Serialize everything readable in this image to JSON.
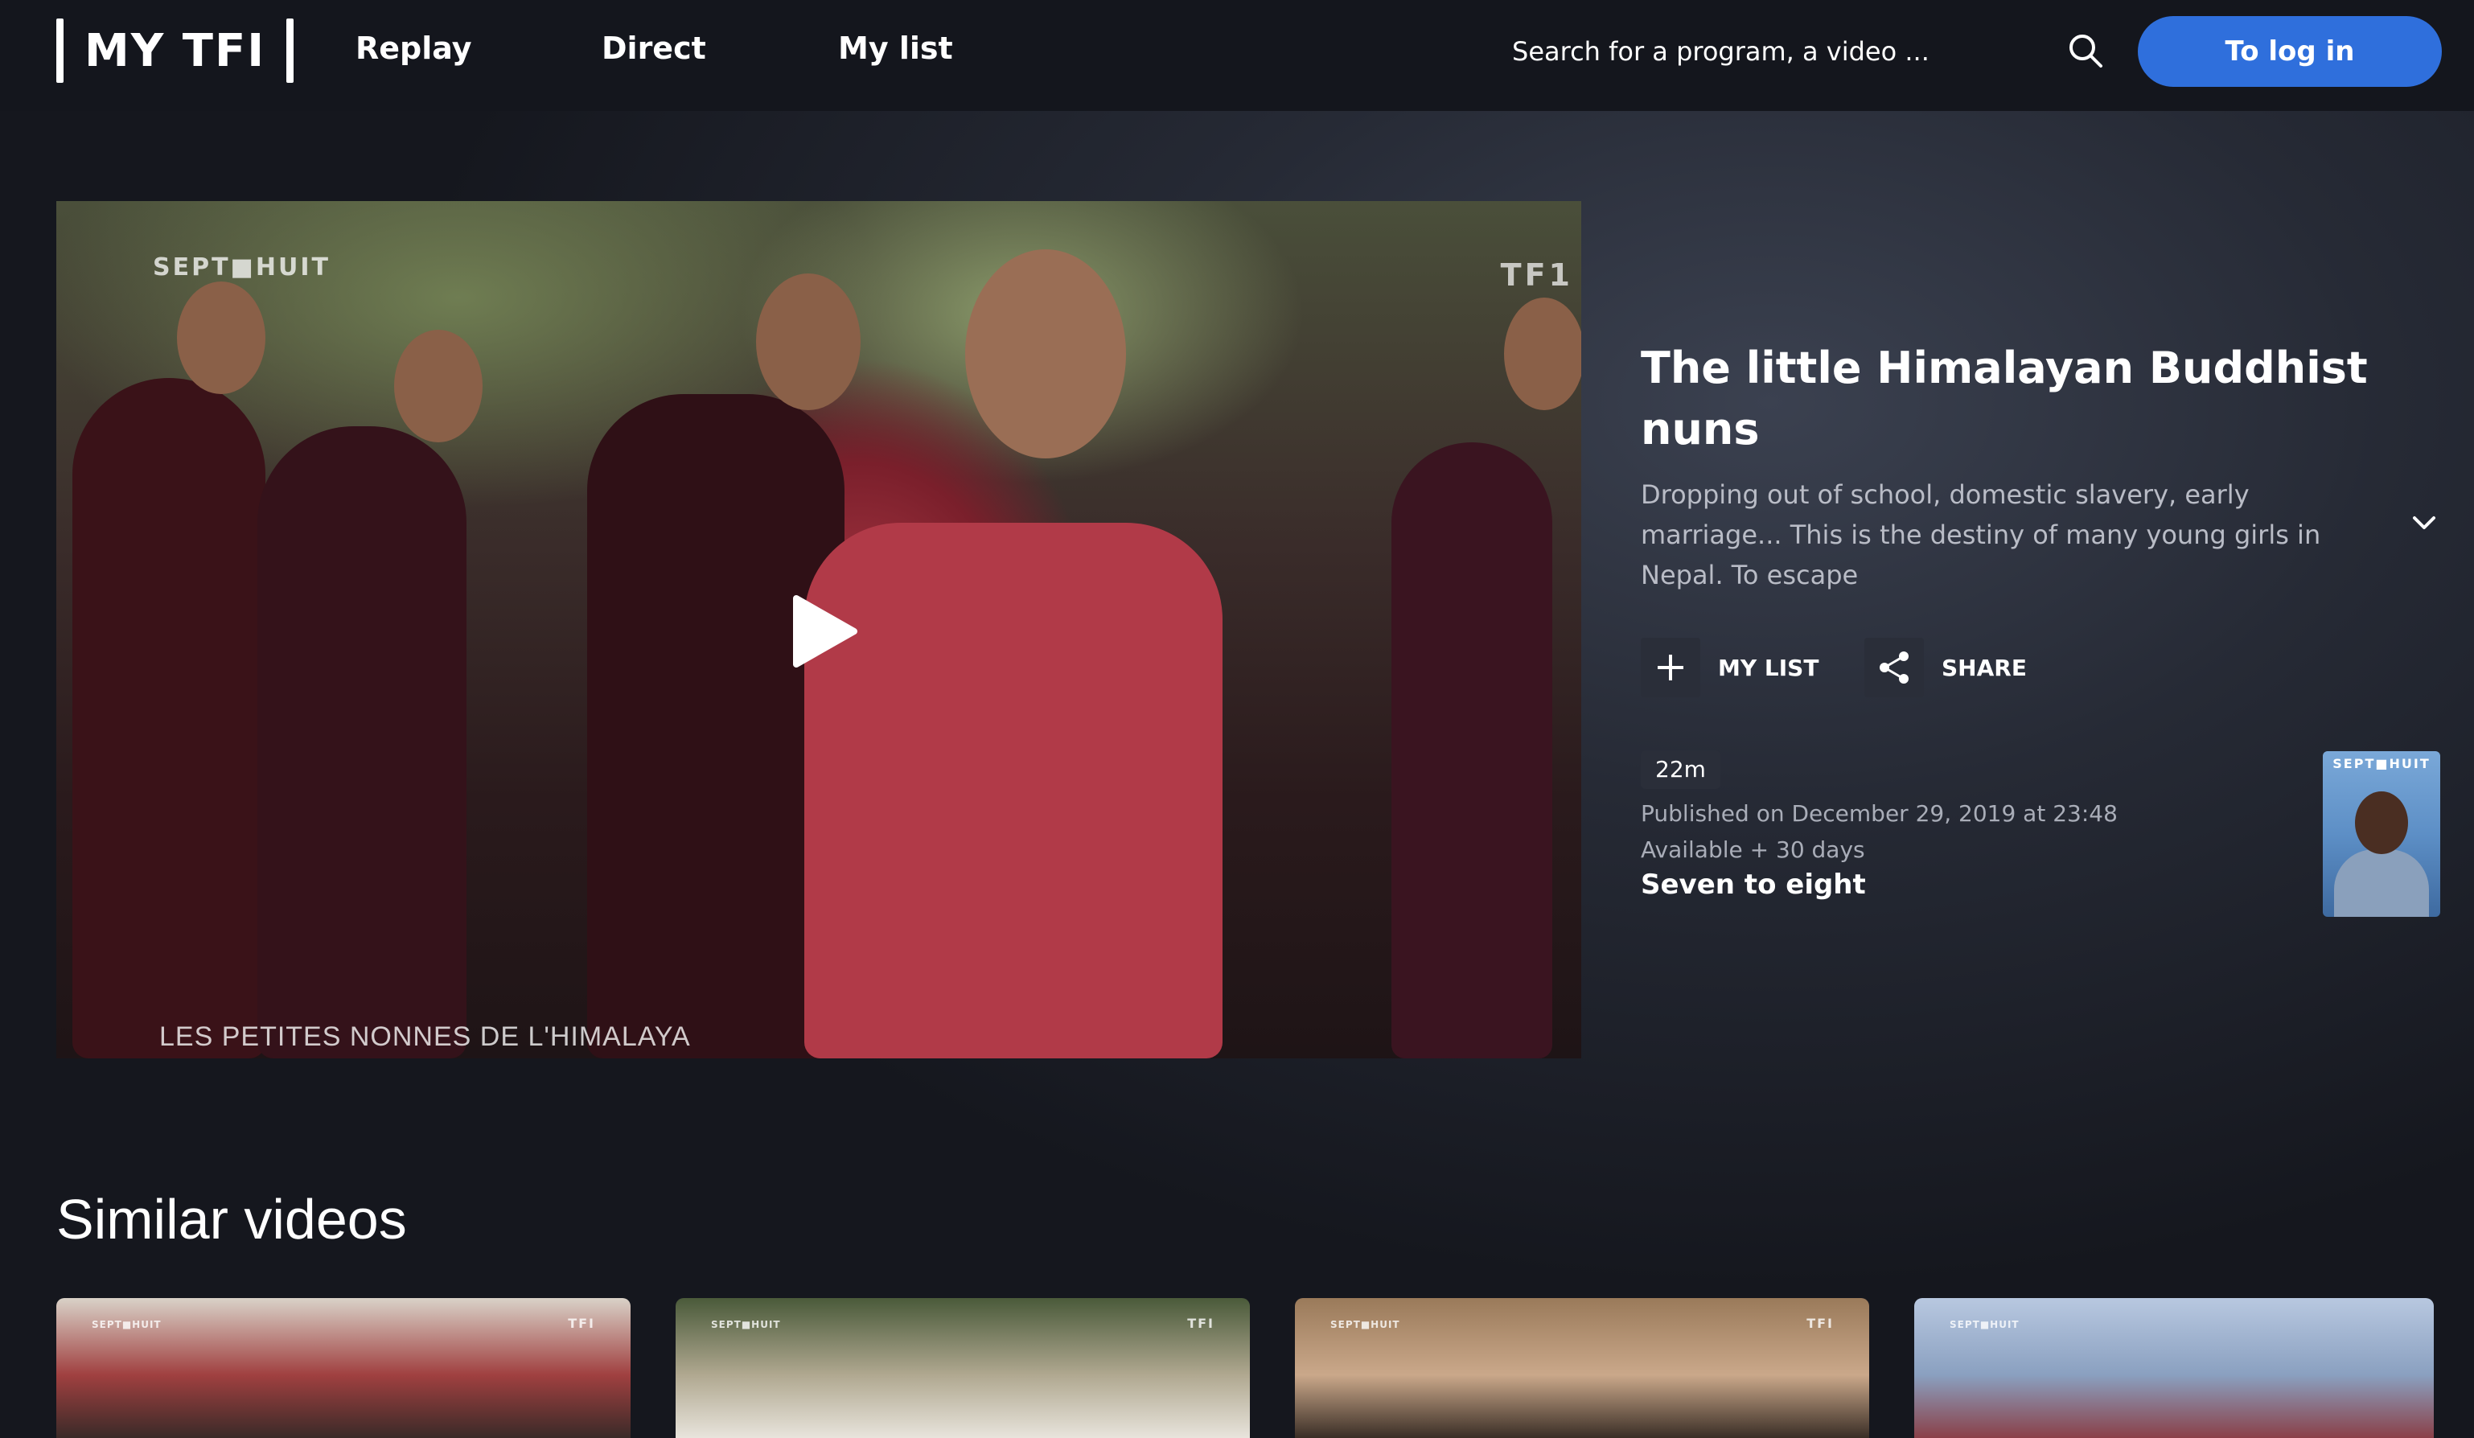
{
  "header": {
    "logo_text": "MY TFI",
    "nav": [
      "Replay",
      "Direct",
      "My list"
    ],
    "search_placeholder": "Search for a program, a video ...",
    "login_label": "To log in"
  },
  "player": {
    "channel_watermark": "SEPT■HUIT",
    "tf1_watermark": "TF1",
    "caption": "LES PETITES NONNES DE L'HIMALAYA"
  },
  "video": {
    "title": "The little Himalayan Buddhist nuns",
    "description": "Dropping out of school, domestic slavery, early marriage... This is the destiny of many young girls in Nepal. To escape",
    "actions": {
      "my_list": "MY LIST",
      "share": "SHARE"
    },
    "duration": "22m",
    "published": "Published on December 29, 2019 at 23:48",
    "availability": "Available + 30 days",
    "program": "Seven to eight",
    "program_thumb_brand": "SEPT■HUIT"
  },
  "similar": {
    "title": "Similar videos",
    "items": [
      {
        "wm": "SEPT■HUIT",
        "wm2": "TFI",
        "colors": [
          "#d9d2c8",
          "#a04040",
          "#3a2a28"
        ]
      },
      {
        "wm": "SEPT■HUIT",
        "wm2": "TFI",
        "colors": [
          "#4a5a3a",
          "#b0a890",
          "#e8e4dc"
        ]
      },
      {
        "wm": "SEPT■HUIT",
        "wm2": "TFI",
        "colors": [
          "#9a7a5a",
          "#caa88a",
          "#3a2e26"
        ]
      },
      {
        "wm": "SEPT■HUIT",
        "wm2": "",
        "colors": [
          "#b8c8e0",
          "#8aa0c0",
          "#8a4048"
        ]
      }
    ]
  },
  "colors": {
    "accent": "#2f6fdc",
    "header_bg": "#14161d"
  }
}
